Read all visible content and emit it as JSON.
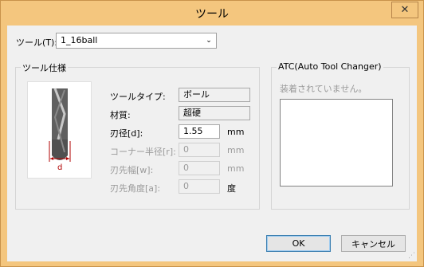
{
  "window": {
    "title": "ツール",
    "close_glyph": "✕",
    "colors": {
      "frame": "#f4c67e",
      "client": "#f0f0f0"
    }
  },
  "tool": {
    "label": "ツール(T):",
    "selected": "1_16ball"
  },
  "spec": {
    "group_title": "ツール仕様",
    "image_label": "d",
    "rows": [
      {
        "label": "ツールタイプ:",
        "value": "ボール",
        "unit": ""
      },
      {
        "label": "材質:",
        "value": "超硬",
        "unit": ""
      },
      {
        "label": "刃径[d]:",
        "value": "1.55",
        "unit": "mm"
      },
      {
        "label": "コーナー半径[r]:",
        "value": "0",
        "unit": "mm"
      },
      {
        "label": "刃先幅[w]:",
        "value": "0",
        "unit": "mm"
      },
      {
        "label": "刃先角度[a]:",
        "value": "0",
        "unit": "度"
      }
    ]
  },
  "atc": {
    "group_title": "ATC(Auto Tool Changer)",
    "status": "装着されていません。"
  },
  "buttons": {
    "ok": "OK",
    "cancel": "キャンセル"
  }
}
